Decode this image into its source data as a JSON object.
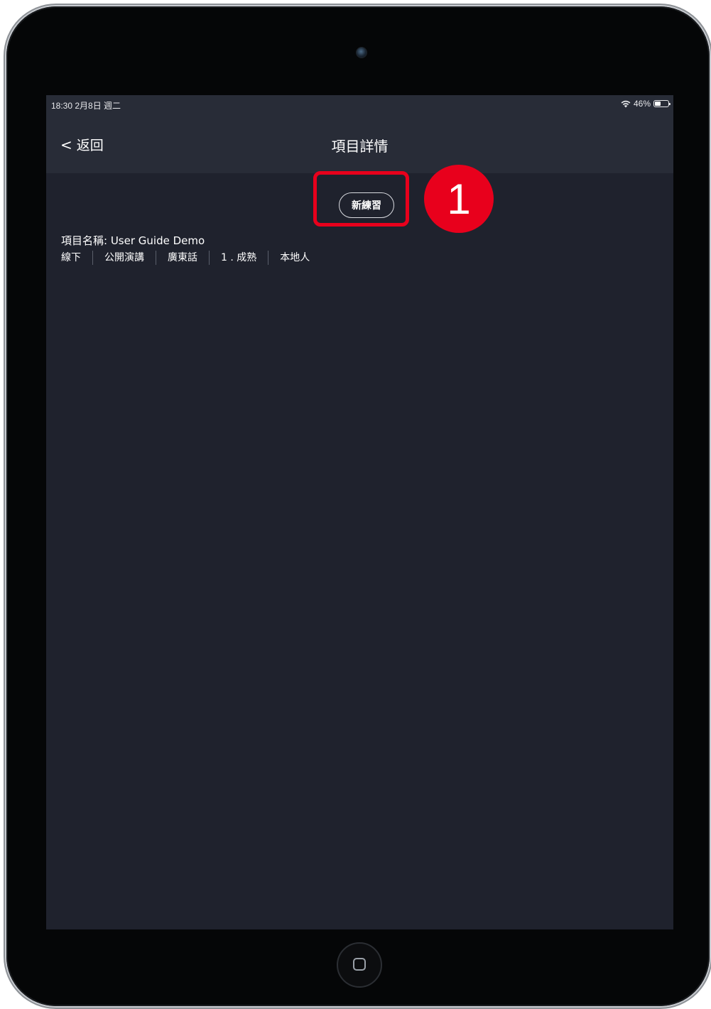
{
  "status_bar": {
    "time_date": "18:30  2月8日 週二",
    "battery_percent": "46%",
    "battery_level": 0.46
  },
  "nav": {
    "back_label": "返回",
    "title": "項目詳情"
  },
  "main": {
    "new_practice_label": "新練習",
    "project_name": "項目名稱: User Guide Demo",
    "tags": [
      "線下",
      "公開演講",
      "廣東話",
      "1 . 成熟",
      "本地人"
    ]
  },
  "annotation": {
    "step_number": "1",
    "highlight_color": "#e8001c"
  },
  "colors": {
    "screen_background": "#1f222d",
    "nav_background": "#282c37"
  }
}
